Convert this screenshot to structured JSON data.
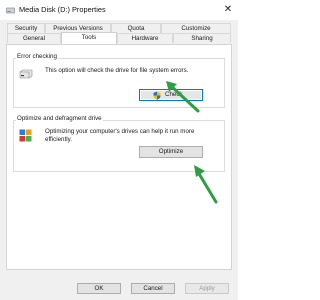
{
  "window": {
    "title": "Media Disk (D:) Properties",
    "close_glyph": "✕"
  },
  "tabs": {
    "row_top": [
      "Security",
      "Previous Versions",
      "Quota",
      "Customize"
    ],
    "row_bottom": [
      "General",
      "Tools",
      "Hardware",
      "Sharing"
    ],
    "active": "Tools"
  },
  "error_checking": {
    "title": "Error checking",
    "description": "This option will check the drive for file system errors.",
    "button_label": "Check"
  },
  "optimize": {
    "title": "Optimize and defragment drive",
    "description": "Optimizing your computer's drives can help it run more efficiently.",
    "button_label": "Optimize"
  },
  "footer": {
    "ok_label": "OK",
    "cancel_label": "Cancel",
    "apply_label": "Apply"
  },
  "colors": {
    "arrow": "#2e9e45",
    "focus_border": "#0078d7",
    "shield_blue": "#1f6fd6",
    "shield_yellow": "#f2c200"
  }
}
